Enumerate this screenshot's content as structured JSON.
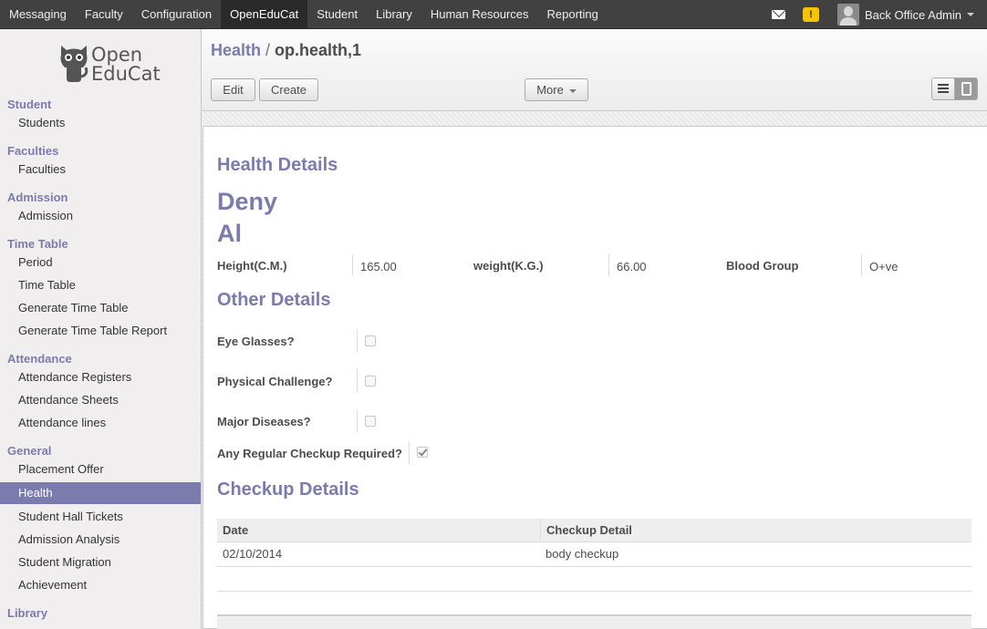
{
  "topbar": {
    "menu": [
      "Messaging",
      "Faculty",
      "Configuration",
      "OpenEduCat",
      "Student",
      "Library",
      "Human Resources",
      "Reporting"
    ],
    "active": "OpenEduCat",
    "user": "Back Office Admin",
    "warning_glyph": "!"
  },
  "sidebar": {
    "logo": {
      "line1": "Open",
      "line2": "EduCat"
    },
    "sections": {
      "student": "Student",
      "faculties": "Faculties",
      "admission": "Admission",
      "timetable": "Time Table",
      "attendance": "Attendance",
      "general": "General",
      "library": "Library"
    },
    "items": {
      "students": "Students",
      "faculties": "Faculties",
      "admission": "Admission",
      "period": "Period",
      "time_table": "Time Table",
      "generate_tt": "Generate Time Table",
      "generate_tt_report": "Generate Time Table Report",
      "att_registers": "Attendance Registers",
      "att_sheets": "Attendance Sheets",
      "att_lines": "Attendance lines",
      "placement": "Placement Offer",
      "health": "Health",
      "hall_tickets": "Student Hall Tickets",
      "admission_analysis": "Admission Analysis",
      "migration": "Student Migration",
      "achievement": "Achievement"
    }
  },
  "header": {
    "breadcrumb_root": "Health",
    "breadcrumb_sep": "/",
    "breadcrumb_current": "op.health,1",
    "edit": "Edit",
    "create": "Create",
    "more": "More"
  },
  "form": {
    "health_details_title": "Health Details",
    "first_name": "Deny",
    "last_name": "Al",
    "height_label": "Height(C.M.)",
    "height_value": "165.00",
    "weight_label": "weight(K.G.)",
    "weight_value": "66.00",
    "blood_label": "Blood Group",
    "blood_value": "O+ve",
    "other_details_title": "Other Details",
    "eye_glasses_label": "Eye Glasses?",
    "eye_glasses": false,
    "physical_label": "Physical Challenge?",
    "physical": false,
    "major_label": "Major Diseases?",
    "major": false,
    "regular_label": "Any Regular Checkup Required?",
    "regular": true,
    "checkup_title": "Checkup Details",
    "table": {
      "headers": [
        "Date",
        "Checkup Detail"
      ],
      "rows": [
        [
          "02/10/2014",
          "body checkup"
        ]
      ]
    }
  },
  "colors": {
    "accent": "#7c7bad",
    "topbar": "#414141"
  }
}
